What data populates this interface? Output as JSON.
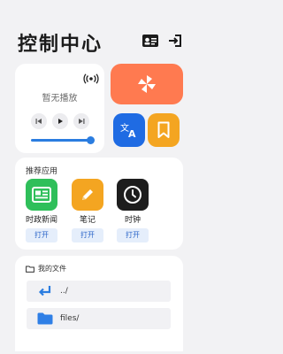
{
  "header": {
    "title": "控制中心",
    "contact_card_icon": "contact-card-icon",
    "login_icon": "login-icon"
  },
  "media": {
    "status": "暂无播放",
    "cast_icon": "broadcast-icon",
    "progress": 1.0
  },
  "quick_tiles": {
    "pinwheel": "pinwheel-icon",
    "translate": "translate-icon",
    "bookmark": "bookmark-icon"
  },
  "apps": {
    "section_title": "推荐应用",
    "items": [
      {
        "label": "时政新闻",
        "button": "打开",
        "icon": "news-icon",
        "color": "#2fbf5a"
      },
      {
        "label": "笔记",
        "button": "打开",
        "icon": "pencil-icon",
        "color": "#f4a521"
      },
      {
        "label": "时钟",
        "button": "打开",
        "icon": "clock-icon",
        "color": "#1d1d1d"
      }
    ]
  },
  "files": {
    "section_title": "我的文件",
    "rows": [
      {
        "name": "../",
        "icon": "return-arrow-icon"
      },
      {
        "name": "files/",
        "icon": "folder-icon"
      }
    ]
  },
  "colors": {
    "accent_blue": "#2b7de0",
    "orange_tile": "#ff7a50",
    "translate_blue": "#1f6be3",
    "bookmark_yellow": "#f4a521"
  }
}
